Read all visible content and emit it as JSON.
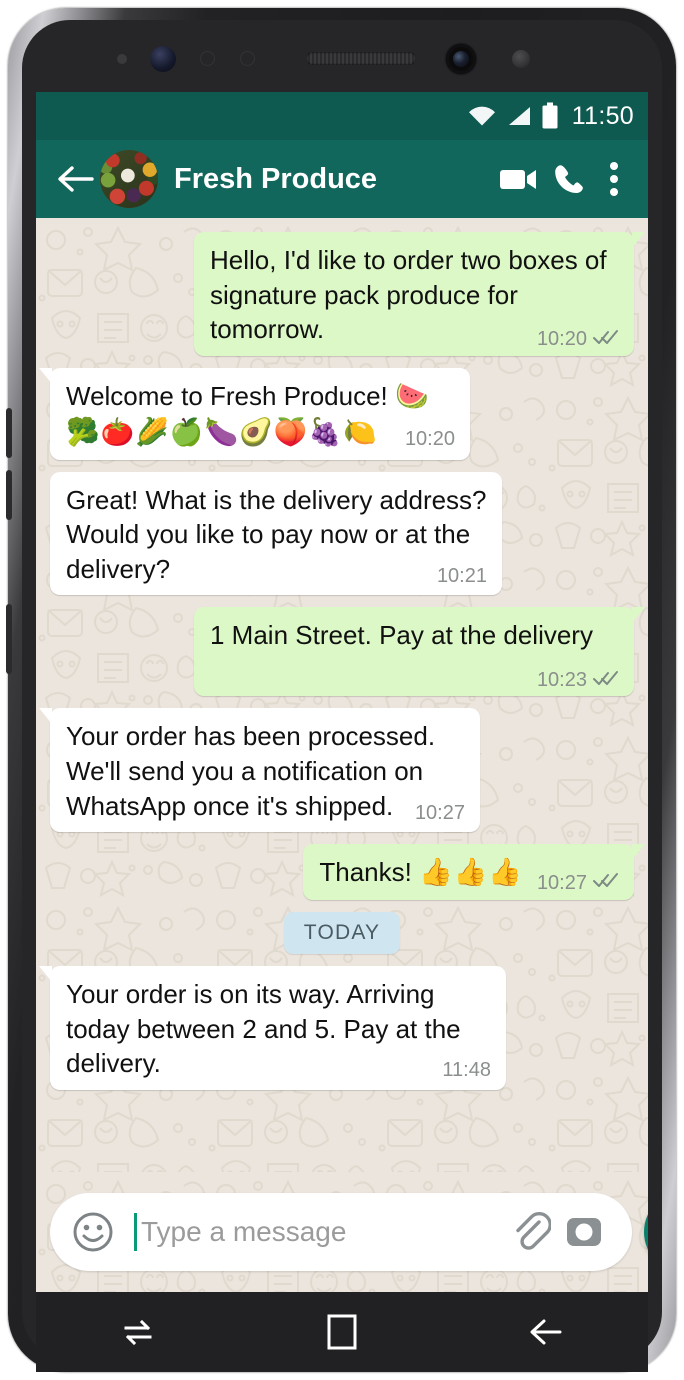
{
  "status_bar": {
    "time": "11:50",
    "icons": [
      "wifi-icon",
      "cellular-signal-icon",
      "battery-icon"
    ]
  },
  "chat_header": {
    "back_icon": "back-arrow-icon",
    "contact_name": "Fresh Produce",
    "avatar": "contact-avatar-produce-photo",
    "actions": [
      {
        "name": "video-call-icon"
      },
      {
        "name": "voice-call-icon"
      },
      {
        "name": "overflow-menu-icon"
      }
    ]
  },
  "messages": [
    {
      "id": "msg-1",
      "direction": "out",
      "text": "Hello, I'd like to order two boxes of signature pack produce for tomorrow.",
      "emoji": "",
      "time": "10:20",
      "status": "read",
      "tail": true
    },
    {
      "id": "msg-2",
      "direction": "in",
      "text": "Welcome to Fresh Produce! ",
      "emoji": "🍉🥦🍅🌽🍏🍆🥑🍑🍇🍋",
      "time": "10:20",
      "status": "none",
      "tail": true
    },
    {
      "id": "msg-3",
      "direction": "in",
      "text": "Great! What is the delivery address? Would you like to pay now or at the delivery?",
      "emoji": "",
      "time": "10:21",
      "status": "none",
      "tail": false
    },
    {
      "id": "msg-4",
      "direction": "out",
      "text": "1 Main Street. Pay at the delivery",
      "emoji": "",
      "time": "10:23",
      "status": "read",
      "tail": true
    },
    {
      "id": "msg-5",
      "direction": "in",
      "text": "Your order has been processed. We'll send you a notification on WhatsApp once it's shipped.",
      "emoji": "",
      "time": "10:27",
      "status": "none",
      "tail": true
    },
    {
      "id": "msg-6",
      "direction": "out",
      "text": "Thanks! ",
      "emoji": "👍👍👍",
      "time": "10:27",
      "status": "read",
      "tail": true
    }
  ],
  "date_divider": {
    "label": "TODAY"
  },
  "messages_after_divider": [
    {
      "id": "msg-7",
      "direction": "in",
      "text": "Your order is on its way. Arriving today between 2 and 5. Pay at the delivery.",
      "emoji": "",
      "time": "11:48",
      "status": "none",
      "tail": true
    }
  ],
  "input_bar": {
    "emoji_icon": "smiley-face-icon",
    "placeholder": "Type a message",
    "value": "",
    "attach_icon": "paperclip-icon",
    "camera_icon": "camera-icon",
    "mic_icon": "microphone-icon"
  },
  "nav_bar": {
    "recents_icon": "recent-apps-icon",
    "home_icon": "home-icon",
    "back_icon": "nav-back-icon"
  },
  "colors": {
    "header_green": "#12675c",
    "status_bar_green": "#0f5a50",
    "outgoing_bubble": "#dcf8c6",
    "incoming_bubble": "#ffffff",
    "chat_background": "#ece5dd",
    "mic_button_green": "#08806b",
    "date_divider_blue": "#cfe5f0",
    "cursor_green": "#0b9a74",
    "nav_bar_dark": "#212123"
  }
}
